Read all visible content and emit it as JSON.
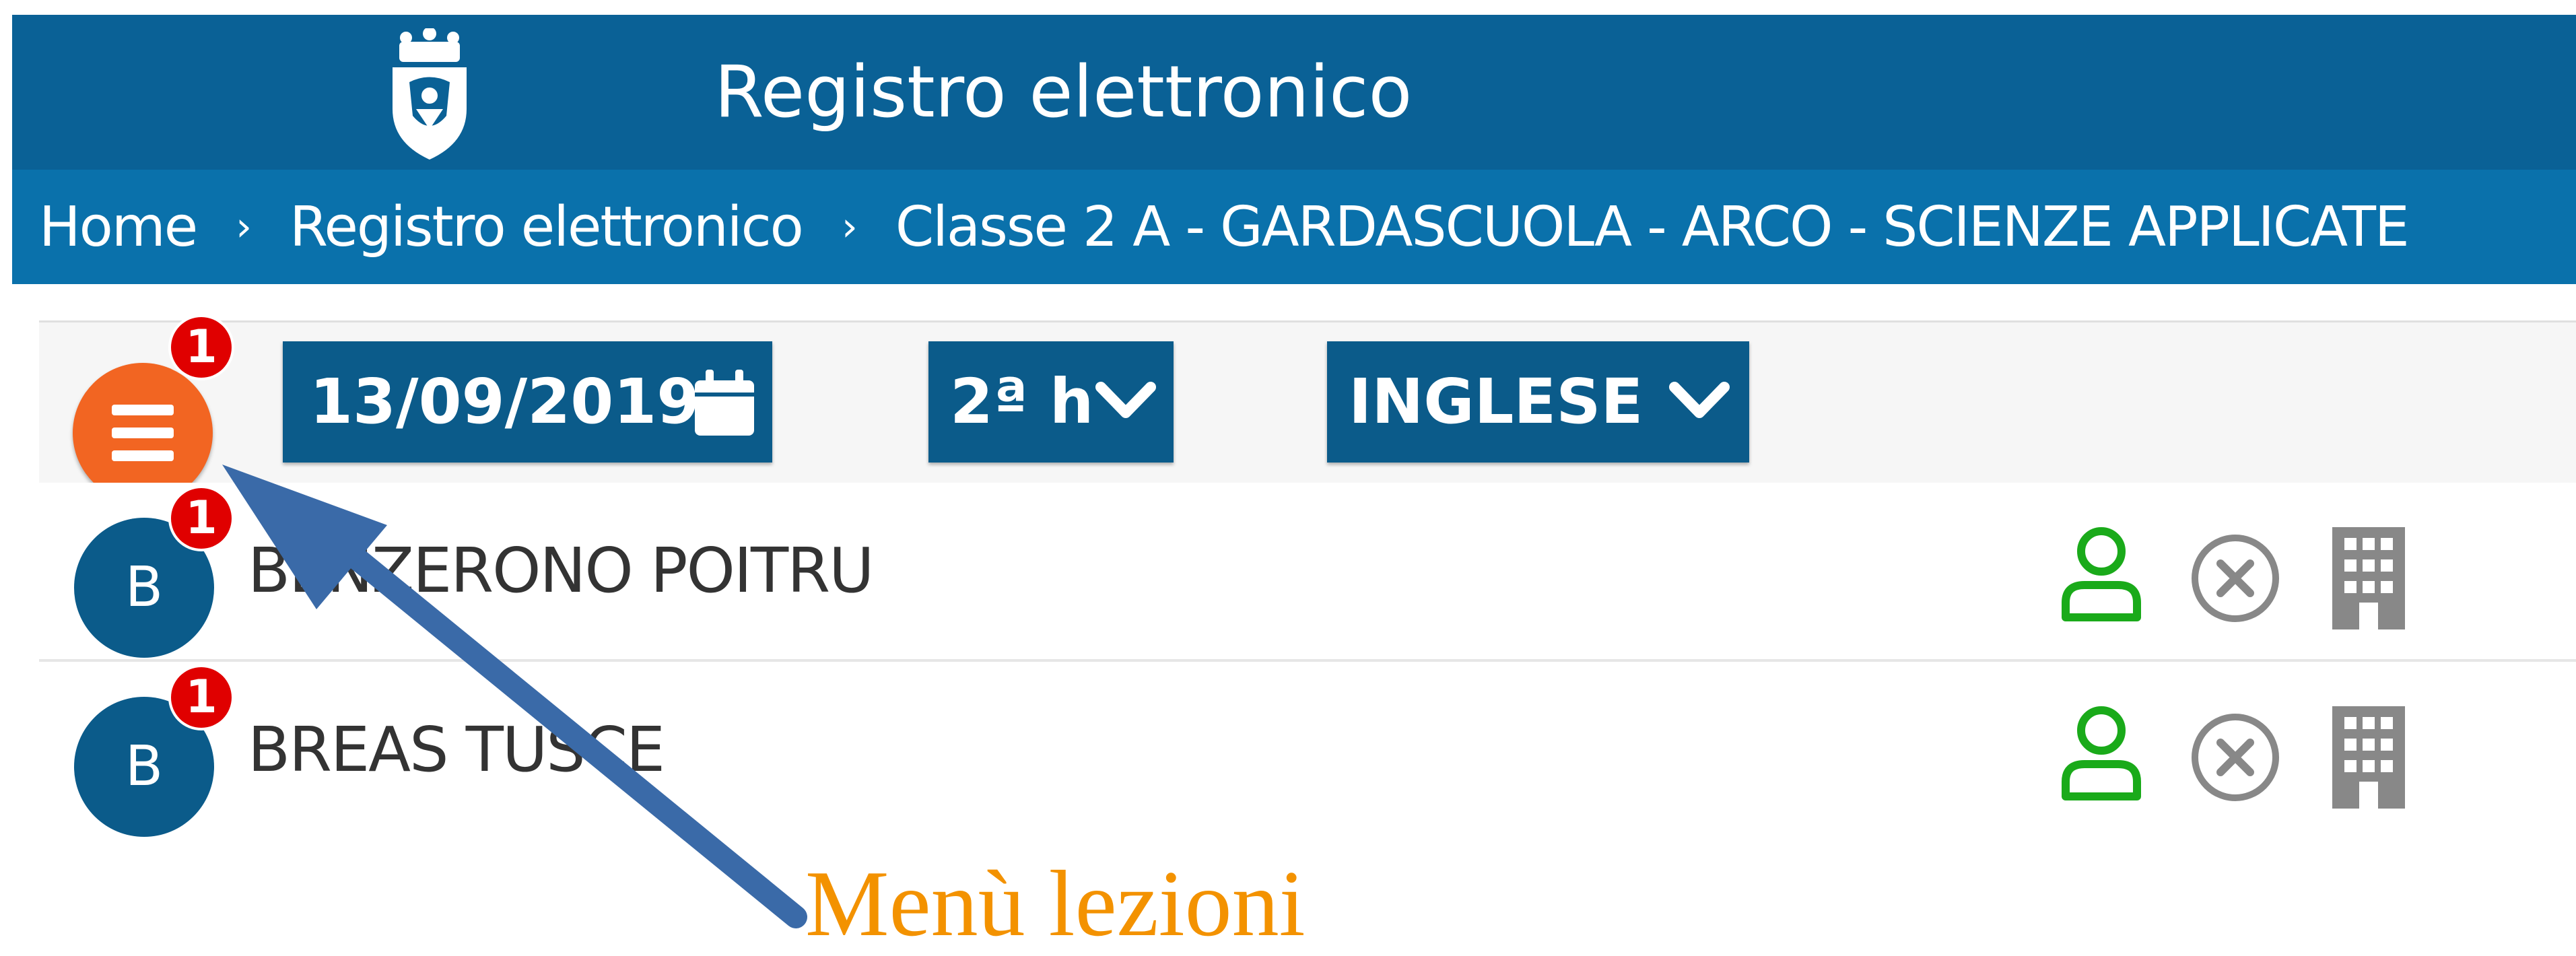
{
  "header": {
    "title": "Registro elettronico",
    "logo_icon": "coat-of-arms-logo"
  },
  "breadcrumb": {
    "items": [
      "Home",
      "Registro elettronico",
      "Classe 2 A - GARDASCUOLA - ARCO - SCIENZE APPLICATE"
    ],
    "separator": "›"
  },
  "toolbar": {
    "menu_badge": "1",
    "date": "13/09/2019",
    "date_icon": "calendar-icon",
    "hour": "2ª h",
    "subject": "INGLESE"
  },
  "students": [
    {
      "initial": "B",
      "name": "BENZERONO POITRU",
      "badge": "1"
    },
    {
      "initial": "B",
      "name": "BREAS TUSCE",
      "badge": "1"
    }
  ],
  "row_icons": [
    "person-present-icon",
    "absent-x-icon",
    "building-icon"
  ],
  "colors": {
    "header_bg": "#0a6196",
    "breadcrumb_bg": "#0a71ab",
    "button_bg": "#0b5b8a",
    "menu_orange": "#f26522",
    "badge_red": "#e00000",
    "present_green": "#1aaa1a",
    "annotation_orange": "#f39200",
    "arrow_blue": "#3a6aa8"
  },
  "annotation": {
    "label": "Menù lezioni"
  }
}
